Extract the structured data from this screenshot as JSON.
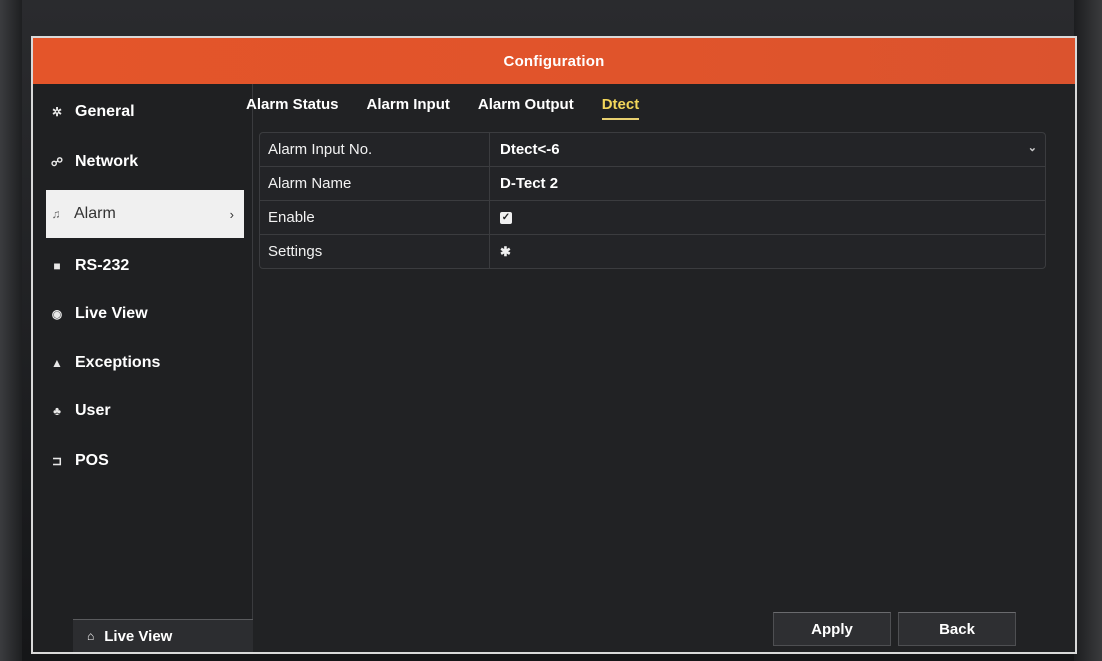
{
  "window": {
    "title": "Configuration"
  },
  "sidebar": {
    "items": [
      {
        "label": "General",
        "icon": "gear-icon"
      },
      {
        "label": "Network",
        "icon": "network-icon"
      },
      {
        "label": "Alarm",
        "icon": "bell-icon",
        "active": true
      },
      {
        "label": "RS-232",
        "icon": "serial-port-icon"
      },
      {
        "label": "Live View",
        "icon": "eye-icon"
      },
      {
        "label": "Exceptions",
        "icon": "warning-icon"
      },
      {
        "label": "User",
        "icon": "users-icon"
      },
      {
        "label": "POS",
        "icon": "pos-icon"
      }
    ],
    "live_view_button": "Live View"
  },
  "tabs": [
    {
      "label": "Alarm Status"
    },
    {
      "label": "Alarm Input"
    },
    {
      "label": "Alarm Output"
    },
    {
      "label": "Dtect",
      "active": true
    }
  ],
  "form": {
    "alarm_input_no": {
      "label": "Alarm Input No.",
      "value": "Dtect<-6"
    },
    "alarm_name": {
      "label": "Alarm Name",
      "value": "D-Tect 2"
    },
    "enable": {
      "label": "Enable",
      "checked": true
    },
    "settings": {
      "label": "Settings",
      "icon": "gear-icon"
    }
  },
  "buttons": {
    "apply": "Apply",
    "back": "Back"
  },
  "colors": {
    "title_bar": "#e4552a",
    "active_tab": "#f2d65a",
    "background": "#212224"
  }
}
